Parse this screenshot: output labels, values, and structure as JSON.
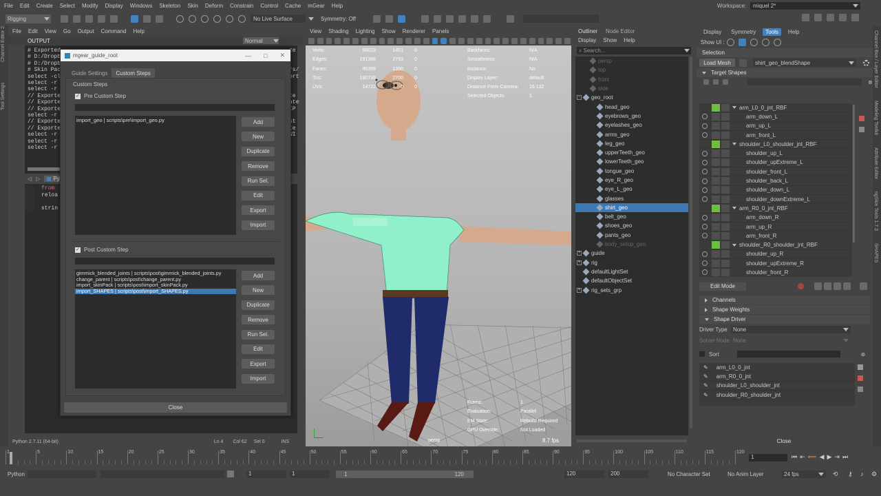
{
  "menubar": {
    "items": [
      "File",
      "Edit",
      "Create",
      "Select",
      "Modify",
      "Display",
      "Windows",
      "Skeleton",
      "Skin",
      "Deform",
      "Constrain",
      "Control",
      "Cache",
      "mGear",
      "Help"
    ],
    "workspace_label": "Workspace:",
    "workspace_value": "miquel 2*"
  },
  "toolbar": {
    "mode": "Rigging",
    "live_surface": "No Live Surface",
    "symmetry": "Symmetry: Off"
  },
  "script_editor": {
    "menu": [
      "File",
      "Edit",
      "View",
      "Go",
      "Output",
      "Command",
      "Help"
    ],
    "output_label": "OUTPUT",
    "normal_select": "Normal",
    "output_lines": [
      "# Exported",
      "# D:/Dropb",
      "# D:/Dropb",
      "# Skin Pac",
      "select -cl",
      "select -r",
      "select -r",
      "// Exporte",
      "// Exporte",
      "// Exporte",
      "select -r",
      "// Exporte",
      "// Exporte",
      "select -r",
      "select -r",
      "select -r"
    ],
    "output_right": [
      "ze",
      "",
      "",
      "rs/",
      "ort",
      "",
      "",
      "te",
      "ate",
      "IP",
      "",
      "st",
      "te",
      "WI",
      "",
      ""
    ],
    "python_tab": "Py",
    "code_lines": [
      "from",
      "reloa",
      "",
      "strin"
    ],
    "status_python": "Python 2.7.11 (64-bit)",
    "ln": "Ln 4",
    "col": "Col 62",
    "sel": "Sel 0",
    "ins": "INS"
  },
  "guide_dialog": {
    "title": "mgear_guide_root",
    "tabs": [
      "Guide Settings",
      "Custom Steps"
    ],
    "group_label": "Custom Steps",
    "pre_label": "Pre Custom Step",
    "pre_items": [
      "import_geo | scripts\\pre\\import_geo.py"
    ],
    "post_label": "Post  Custom Step",
    "post_items": [
      "gimmick_blended_joints | scripts\\post\\gimmick_blended_joints.py",
      "change_parent | scripts\\post\\change_parent.py",
      "import_skinPack | scripts\\post\\import_skinPack.py",
      "import_SHAPES | scripts\\post\\import_SHAPES.py"
    ],
    "post_selected": 3,
    "buttons": [
      "Add",
      "New",
      "Duplicate",
      "Remove",
      "Run Sel.",
      "Edit",
      "Export",
      "Import"
    ],
    "close": "Close"
  },
  "viewport": {
    "menu": [
      "View",
      "Shading",
      "Lighting",
      "Show",
      "Renderer",
      "Panels"
    ],
    "hud_left": [
      [
        "Verts:",
        "96023",
        "1401",
        "0"
      ],
      [
        "Edges:",
        "191398",
        "2753",
        "0"
      ],
      [
        "Faces:",
        "95399",
        "1350",
        "0"
      ],
      [
        "Tris:",
        "190736",
        "2700",
        "0"
      ],
      [
        "UVs:",
        "14722",
        "0",
        "0"
      ]
    ],
    "hud_right": [
      [
        "Backfaces:",
        "N/A"
      ],
      [
        "Smoothness:",
        "N/A"
      ],
      [
        "Instance:",
        "No"
      ],
      [
        "Display Layer:",
        "default"
      ],
      [
        "Distance From Camera:",
        "16.132"
      ],
      [
        "Selected Objects:",
        "1"
      ]
    ],
    "hud_bottom": [
      [
        "Frame:",
        "1"
      ],
      [
        "Evaluation:",
        "Parallel"
      ],
      [
        "EM State:",
        "Rebuild Required"
      ],
      [
        "GPU Override:",
        "Not Loaded"
      ]
    ],
    "camera": "persp",
    "fps": "8.7 fps"
  },
  "outliner": {
    "title_tabs": [
      "Outliner",
      "Node Editor"
    ],
    "menu": [
      "Display",
      "Show",
      "Help"
    ],
    "search_placeholder": "Search...",
    "items": [
      {
        "label": "persp",
        "indent": 1,
        "dim": true
      },
      {
        "label": "top",
        "indent": 1,
        "dim": true
      },
      {
        "label": "front",
        "indent": 1,
        "dim": true
      },
      {
        "label": "side",
        "indent": 1,
        "dim": true
      },
      {
        "label": "geo_root",
        "indent": 0,
        "dim": false,
        "expander": "-"
      },
      {
        "label": "head_geo",
        "indent": 2,
        "dim": false
      },
      {
        "label": "eyebrows_geo",
        "indent": 2,
        "dim": false
      },
      {
        "label": "eyelashes_geo",
        "indent": 2,
        "dim": false
      },
      {
        "label": "arms_geo",
        "indent": 2,
        "dim": false
      },
      {
        "label": "leg_geo",
        "indent": 2,
        "dim": false
      },
      {
        "label": "upperTeeth_geo",
        "indent": 2,
        "dim": false
      },
      {
        "label": "lowerTeeth_geo",
        "indent": 2,
        "dim": false
      },
      {
        "label": "tongue_geo",
        "indent": 2,
        "dim": false
      },
      {
        "label": "eye_R_geo",
        "indent": 2,
        "dim": false
      },
      {
        "label": "eye_L_geo",
        "indent": 2,
        "dim": false
      },
      {
        "label": "glasses",
        "indent": 2,
        "dim": false
      },
      {
        "label": "shirt_geo",
        "indent": 2,
        "dim": false,
        "selected": true
      },
      {
        "label": "belt_geo",
        "indent": 2,
        "dim": false
      },
      {
        "label": "shoes_geo",
        "indent": 2,
        "dim": false
      },
      {
        "label": "pants_geo",
        "indent": 2,
        "dim": false
      },
      {
        "label": "body_setup_geo",
        "indent": 2,
        "dim": true
      },
      {
        "label": "guide",
        "indent": 0,
        "dim": false,
        "expander": "+"
      },
      {
        "label": "rig",
        "indent": 0,
        "dim": false,
        "expander": "+"
      },
      {
        "label": "defaultLightSet",
        "indent": 0,
        "dim": false
      },
      {
        "label": "defaultObjectSet",
        "indent": 0,
        "dim": false
      },
      {
        "label": "rig_sets_grp",
        "indent": 0,
        "dim": false,
        "expander": "+"
      }
    ]
  },
  "shapes": {
    "menu": [
      "Display",
      "Symmetry",
      "Tools",
      "Help"
    ],
    "show_ui": "Show UI :",
    "selection": "Selection",
    "load_mesh": "Load Mesh",
    "blendshape": "shirt_geo_blendShape",
    "target_shapes": "Target Shapes",
    "targets": [
      {
        "label": "arm_L0_0_jnt_RBF",
        "group": true
      },
      {
        "label": "arm_down_L"
      },
      {
        "label": "arm_up_L"
      },
      {
        "label": "arm_front_L"
      },
      {
        "label": "shoulder_L0_shoulder_jnt_RBF",
        "group": true
      },
      {
        "label": "shoulder_up_L"
      },
      {
        "label": "shoulder_upExtreme_L"
      },
      {
        "label": "shoulder_front_L"
      },
      {
        "label": "shoulder_back_L"
      },
      {
        "label": "shoulder_down_L"
      },
      {
        "label": "shoulder_downExtreme_L"
      },
      {
        "label": "arm_R0_0_jnt_RBF",
        "group": true
      },
      {
        "label": "arm_down_R"
      },
      {
        "label": "arm_up_R"
      },
      {
        "label": "arm_front_R"
      },
      {
        "label": "shoulder_R0_shoulder_jnt_RBF",
        "group": true
      },
      {
        "label": "shoulder_up_R"
      },
      {
        "label": "shoulder_upExtreme_R"
      },
      {
        "label": "shoulder_front_R"
      }
    ],
    "edit_mode": "Edit Mode",
    "sections": [
      "Channels",
      "Shape Weights",
      "Shape Driver"
    ],
    "driver_type_label": "Driver Type",
    "driver_type": "None",
    "solver_node_label": "Solver Node",
    "solver_node": "None",
    "sort": "Sort",
    "drivers": [
      "arm_L0_0_jnt",
      "arm_R0_0_jnt",
      "shoulder_L0_shoulder_jnt",
      "shoulder_R0_shoulder_jnt"
    ],
    "close": "Close"
  },
  "timeline": {
    "ticks": [
      "1",
      "5",
      "10",
      "15",
      "20",
      "25",
      "30",
      "35",
      "40",
      "45",
      "50",
      "55",
      "60",
      "65",
      "70",
      "75",
      "80",
      "85",
      "90",
      "95",
      "100",
      "105",
      "110",
      "115",
      "120"
    ],
    "current": "1"
  },
  "range": {
    "lang": "Python",
    "start": "1",
    "start2": "1",
    "slider_start": "1",
    "slider_end": "120",
    "end": "120",
    "end2": "200",
    "character_set": "No Character Set",
    "anim_layer": "No Anim Layer",
    "fps": "24 fps"
  },
  "side_tabs": {
    "left": [
      "Tool Settings",
      "Channel Editor 2"
    ],
    "right": [
      "Channel Box / Layer Editor",
      "Modeling Toolkit",
      "Attribute Editor",
      "ngSkin Tools 1.7.3",
      "SHAPES"
    ]
  }
}
